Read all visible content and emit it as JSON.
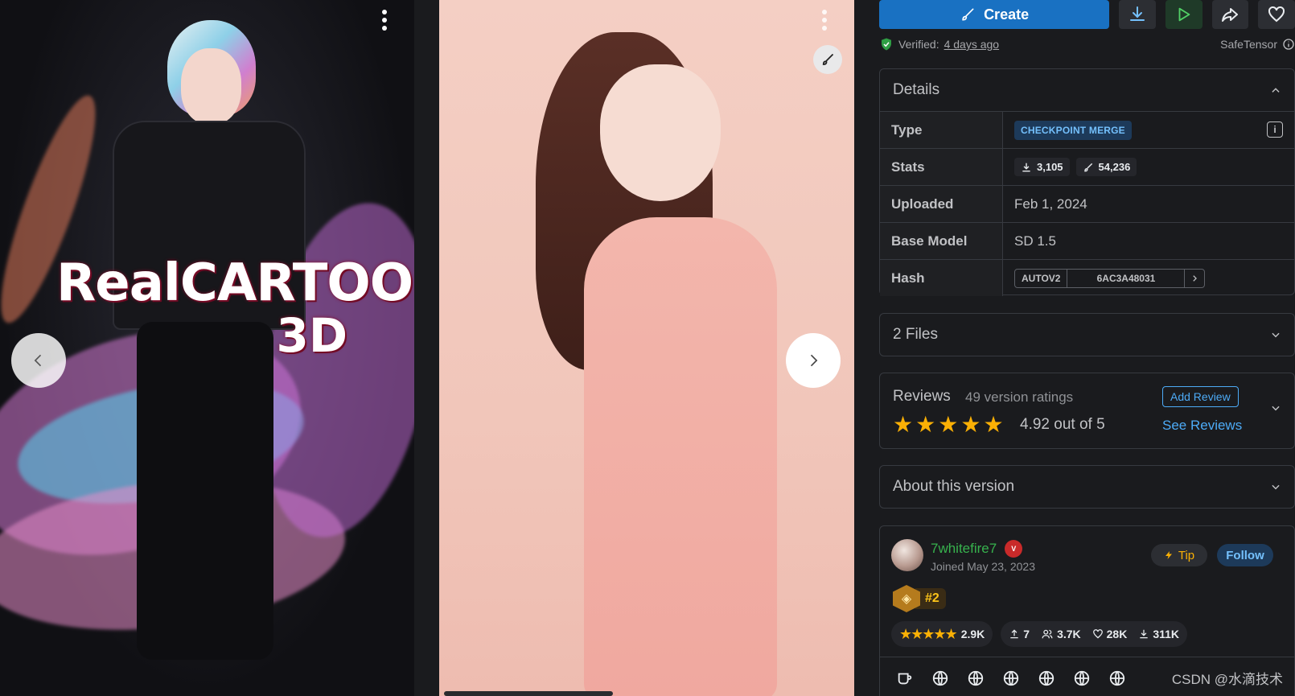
{
  "gallery": {
    "image1": {
      "title_line1": "RealCARTOON",
      "title_line2": "3D"
    },
    "icons": {
      "menu": "more-vertical-icon",
      "remix": "brush-icon",
      "prev": "chevron-left-icon",
      "next": "chevron-right-icon"
    }
  },
  "toolbar": {
    "create_label": "Create",
    "verified_prefix": "Verified:",
    "verified_when": "4 days ago",
    "safetensor": "SafeTensor"
  },
  "details": {
    "heading": "Details",
    "rows": {
      "type_key": "Type",
      "type_value": "CHECKPOINT MERGE",
      "stats_key": "Stats",
      "downloads": "3,105",
      "generations": "54,236",
      "uploaded_key": "Uploaded",
      "uploaded_value": "Feb 1, 2024",
      "base_key": "Base Model",
      "base_value": "SD 1.5",
      "hash_key": "Hash",
      "hash_type": "AUTOV2",
      "hash_value": "6AC3A48031"
    }
  },
  "files": {
    "heading": "2 Files"
  },
  "reviews": {
    "heading": "Reviews",
    "count": "49 version ratings",
    "rating": 4.92,
    "score_text": "4.92 out of 5",
    "add_label": "Add Review",
    "see_label": "See Reviews"
  },
  "about": {
    "heading": "About this version"
  },
  "creator": {
    "username": "7whitefire7",
    "rank_badge": "V",
    "joined": "Joined May 23, 2023",
    "tip_label": "Tip",
    "follow_label": "Follow",
    "rank": "#2",
    "rating_count": "2.9K",
    "uploads": "7",
    "followers": "3.7K",
    "likes": "28K",
    "downloads": "311K"
  },
  "watermark": "CSDN @水滴技术",
  "colors": {
    "accent": "#1971c2",
    "link": "#4dabf7",
    "star": "#fab005",
    "username": "#37b24d"
  }
}
